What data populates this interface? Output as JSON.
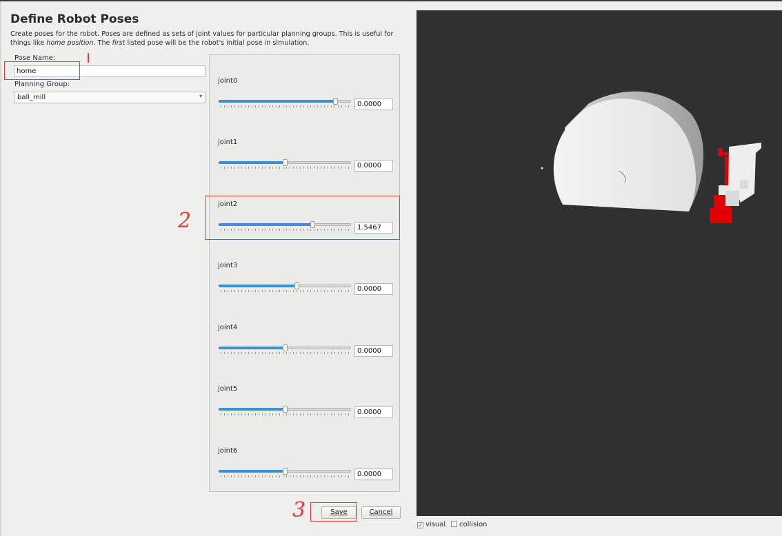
{
  "header": {
    "title": "Define Robot Poses",
    "desc_part1": "Create poses for the robot. Poses are defined as sets of joint values for particular planning groups. This is useful for things like ",
    "desc_italic1": "home position",
    "desc_part2": ". The ",
    "desc_italic2": "first",
    "desc_part3": " listed pose will be the robot's initial pose in simulation."
  },
  "form": {
    "pose_name_label": "Pose Name:",
    "pose_name_value": "home",
    "planning_group_label": "Planning Group:",
    "planning_group_value": "ball_mill"
  },
  "joints": [
    {
      "name": "joint0",
      "value": "0.0000",
      "slider_fraction": 0.88
    },
    {
      "name": "joint1",
      "value": "0.0000",
      "slider_fraction": 0.5
    },
    {
      "name": "joint2",
      "value": "1.5467",
      "slider_fraction": 0.71
    },
    {
      "name": "joint3",
      "value": "0.0000",
      "slider_fraction": 0.59
    },
    {
      "name": "joint4",
      "value": "0.0000",
      "slider_fraction": 0.5
    },
    {
      "name": "joint5",
      "value": "0.0000",
      "slider_fraction": 0.5
    },
    {
      "name": "joint6",
      "value": "0.0000",
      "slider_fraction": 0.5
    }
  ],
  "buttons": {
    "save_label": "Save",
    "cancel_label": "Cancel"
  },
  "viewer": {
    "visual_label": "visual",
    "visual_checked": true,
    "collision_label": "collision",
    "collision_checked": false
  },
  "annotations": {
    "step2": "2",
    "step3": "3"
  },
  "colors": {
    "viewport_bg": "#303030",
    "slider_fill": "#3a8fd6",
    "annotation": "#e03a3a",
    "robot": "#e00000"
  }
}
